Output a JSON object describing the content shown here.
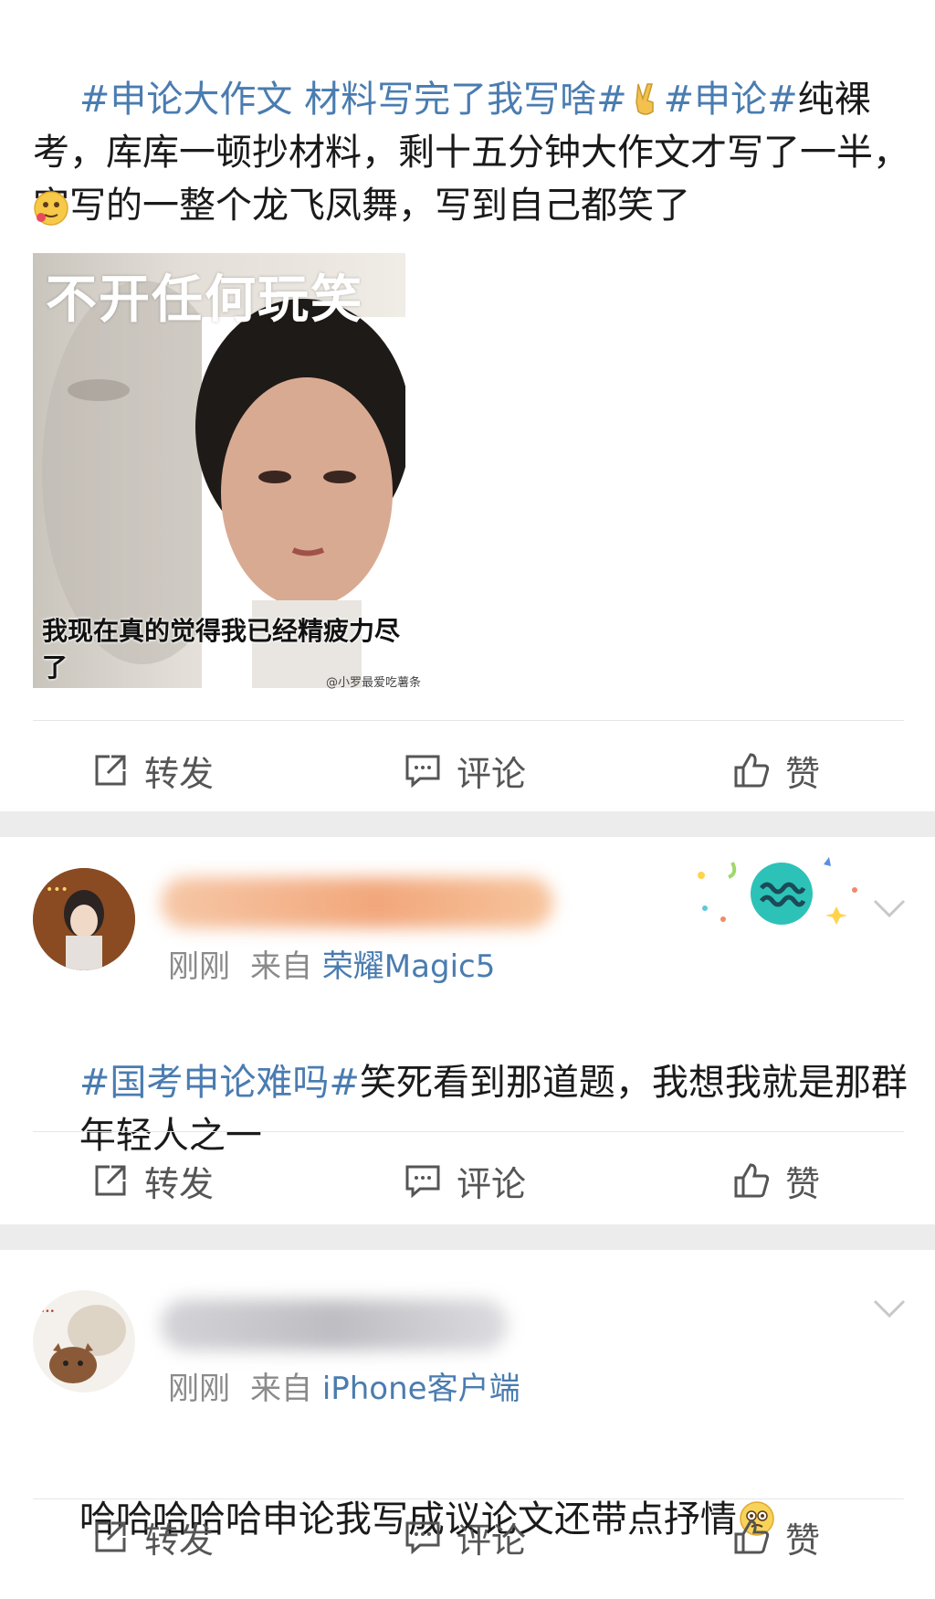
{
  "posts": [
    {
      "tag1": "#申论大作文 材料写完了我写啥#",
      "tag2": "#申论#",
      "body": "纯裸考，库库一顿抄材料，剩十五分钟大作文才写了一半，字写的一整个龙飞凤舞，写到自己都笑了",
      "meme": {
        "top_text": "不开任何玩笑",
        "bottom_text": "我现在真的觉得我已经精疲力尽了",
        "watermark": "@小罗最爱吃薯条"
      }
    },
    {
      "time": "刚刚",
      "from": "来自",
      "source": "荣耀Magic5",
      "tag": "#国考申论难吗#",
      "body_line1": "笑死看到那道题，我想我就是那群",
      "body_line2": "年轻人之一"
    },
    {
      "time": "刚刚",
      "from": "来自",
      "source": "iPhone客户端",
      "body": "哈哈哈哈哈申论我写成议论文还带点抒情"
    }
  ],
  "actions": {
    "repost": "转发",
    "comment": "评论",
    "like": "赞"
  },
  "icons": [
    "repost-icon",
    "comment-icon",
    "like-icon",
    "chevron-down-icon",
    "victory-hand-emoji",
    "blush-emoji",
    "awkward-smile-emoji",
    "aquarius-badge"
  ],
  "colors": {
    "link": "#4a7cb0",
    "text": "#1a1a1a",
    "meta": "#8a8a8a",
    "separator": "#ececec"
  }
}
